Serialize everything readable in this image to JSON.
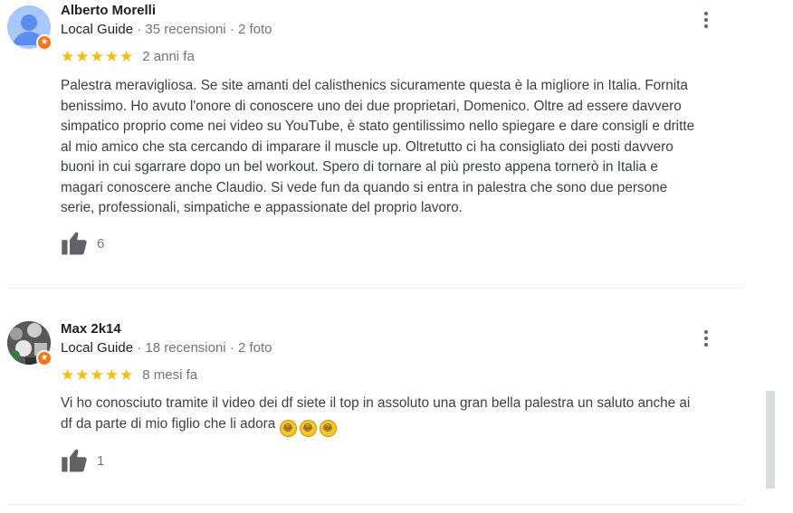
{
  "reviews": [
    {
      "name": "Alberto Morelli",
      "local_guide": "Local Guide",
      "reviews_count": "35 recensioni",
      "photos_count": "2 foto",
      "separator": "·",
      "rating": 5,
      "date": "2 anni fa",
      "text_lines": [
        "Palestra meravigliosa. Se site amanti del calisthenics sicuramente questa è la migliore in Italia. Fornita",
        "benissimo. Ho avuto l'onore di conoscere uno dei due proprietari, Domenico. Oltre ad essere davvero",
        "simpatico proprio come nei video su YouTube, è stato gentilissimo nello spiegare e dare consigli e dritte",
        "al mio amico che sta cercando di imparare il muscle up. Oltretutto ci ha consigliato dei posti davvero",
        "buoni in cui sgarrare dopo un bel workout. Spero di tornare al più presto appena tornerò in Italia e",
        "magari conoscere anche Claudio. Si vede fun da quando si entra in palestra che sono due persone",
        "serie, professionali, simpatiche e appassionate del proprio lavoro."
      ],
      "likes": "6"
    },
    {
      "name": "Max 2k14",
      "local_guide": "Local Guide",
      "reviews_count": "18 recensioni",
      "photos_count": "2 foto",
      "separator": "·",
      "rating": 5,
      "date": "8 mesi fa",
      "text_lines": [
        "Vi ho conosciuto tramite il video dei df siete il top in assoluto una gran bella palestra un saluto anche ai",
        "df da parte di mio figlio che li adora"
      ],
      "emojis": [
        "😂",
        "😂",
        "😂"
      ],
      "likes": "1"
    }
  ],
  "colors": {
    "star": "#fbbc04",
    "badge": "#f97316",
    "avatar_default": "#a8c7fa"
  },
  "icons": {
    "thumb": "thumbs-up-icon",
    "more": "more-vert-icon",
    "badge": "local-guide-star-icon"
  }
}
